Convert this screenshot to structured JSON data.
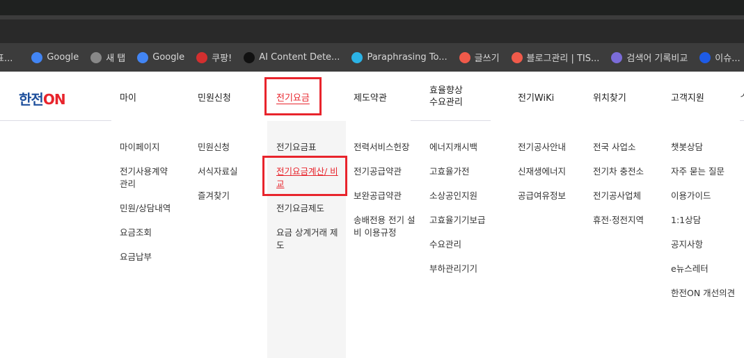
{
  "bookmarks": [
    {
      "label": "표...",
      "icon": "truncated-icon"
    },
    {
      "label": "Google",
      "icon": "google-icon",
      "color": "#4285f4"
    },
    {
      "label": "새 탭",
      "icon": "globe-icon",
      "color": "#888888"
    },
    {
      "label": "Google",
      "icon": "google-icon",
      "color": "#4285f4"
    },
    {
      "label": "쿠팡!",
      "icon": "coupang-icon",
      "color": "#d32f2f"
    },
    {
      "label": "AI Content Dete...",
      "icon": "w-icon",
      "color": "#111111"
    },
    {
      "label": "Paraphrasing To...",
      "icon": "c-icon",
      "color": "#2bb3e6"
    },
    {
      "label": "글쓰기",
      "icon": "tistory-icon",
      "color": "#f05a4a"
    },
    {
      "label": "블로그관리 | TIS...",
      "icon": "tistory-icon",
      "color": "#f05a4a"
    },
    {
      "label": "검색어 기록비교",
      "icon": "rabbit-icon",
      "color": "#7b6cd9"
    },
    {
      "label": "이슈...",
      "icon": "z-icon",
      "color": "#1e5be6"
    }
  ],
  "logo": {
    "part1": "한전",
    "part2": "ON"
  },
  "nav": [
    {
      "label": "마이",
      "items": [
        "마이페이지",
        "전기사용계약 관리",
        "민원/상담내역",
        "요금조회",
        "요금납부"
      ]
    },
    {
      "label": "민원신청",
      "items": [
        "민원신청",
        "서식자료실",
        "즐겨찾기"
      ]
    },
    {
      "label": "전기요금",
      "active": true,
      "items": [
        "전기요금표",
        "전기요금계산/ 비교",
        "전기요금제도",
        "요금 상계거래 제도"
      ],
      "highlighted_item": 1
    },
    {
      "label": "제도약관",
      "items": [
        "전력서비스헌장",
        "전기공급약관",
        "보완공급약관",
        "송배전용 전기 설비 이용규정"
      ]
    },
    {
      "label": "효율향상\n수요관리",
      "items": [
        "에너지캐시백",
        "고효율가전",
        "소상공인지원",
        "고효율기기보급",
        "수요관리",
        "부하관리기기"
      ]
    },
    {
      "label": "전기WiKi",
      "items": [
        "전기공사안내",
        "신재생에너지",
        "공급여유정보"
      ]
    },
    {
      "label": "위치찾기",
      "items": [
        "전국 사업소",
        "전기차 충전소",
        "전기공사업체",
        "휴전·정전지역"
      ]
    },
    {
      "label": "고객지원",
      "items": [
        "챗봇상담",
        "자주 묻는 질문",
        "이용가이드",
        "1:1상담",
        "공지사항",
        "e뉴스레터",
        "한전ON 개선의견"
      ]
    }
  ],
  "colors": {
    "accent": "#e8242c",
    "brand_blue": "#1d4f9c"
  }
}
